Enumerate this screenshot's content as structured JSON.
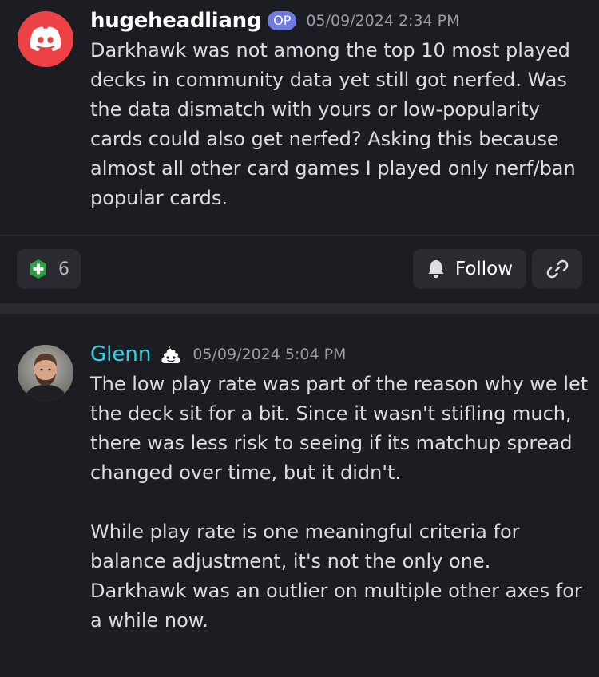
{
  "post": {
    "author": "hugeheadliang",
    "badge": "OP",
    "timestamp": "05/09/2024 2:34 PM",
    "text": "Darkhawk was not among the top 10 most played decks in community data yet still got nerfed. Was the data dismatch with yours or low-popularity cards could also get nerfed? Asking this because almost all other card games I played only nerf/ban popular cards.",
    "avatar_icon": "discord-logo-icon"
  },
  "actions": {
    "reaction_icon": "green-plus-emoji-icon",
    "reaction_count": "6",
    "follow_icon": "bell-icon",
    "follow_label": "Follow",
    "link_icon": "link-icon"
  },
  "reply": {
    "author": "Glenn",
    "role_icon": "poop-emoji-icon",
    "timestamp": "05/09/2024 5:04 PM",
    "text": "The low play rate was part of the reason why we let the deck sit for a bit. Since it wasn't stifling much, there was less risk to seeing if its matchup spread changed over time, but it didn't.\n\nWhile play rate is one meaningful criteria for balance adjustment, it's not the only one. Darkhawk was an outlier on multiple other axes for a while now.",
    "avatar_icon": "profile-photo"
  },
  "colors": {
    "background": "#1c1d22",
    "discord_red": "#ec4246",
    "op_badge": "#6f7be0",
    "glenn_name": "#2fd6e6",
    "reaction_green": "#2ea043",
    "button_bg": "#2a2b31"
  }
}
